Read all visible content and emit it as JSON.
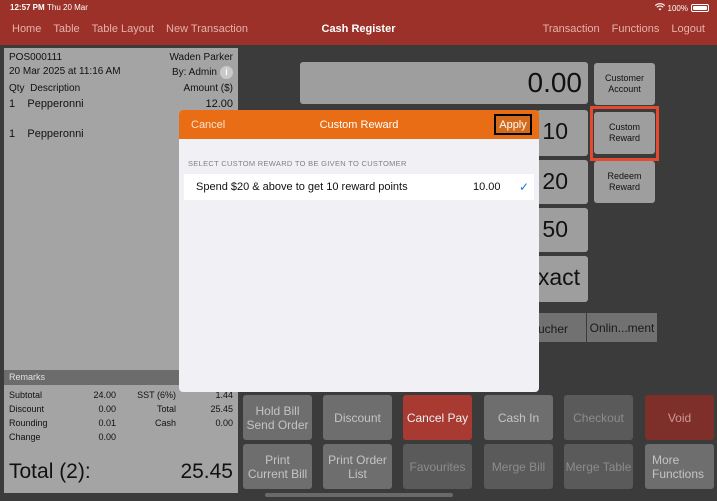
{
  "status": {
    "time": "12:57 PM",
    "date": "Thu 20 Mar",
    "battery": "100%"
  },
  "nav": {
    "left": [
      "Home",
      "Table",
      "Table Layout",
      "New Transaction"
    ],
    "title": "Cash Register",
    "right": [
      "Transaction",
      "Functions",
      "Logout"
    ]
  },
  "receipt": {
    "number": "POS000111",
    "customer": "Waden Parker",
    "datetime": "20 Mar 2025 at 11:16 AM",
    "by": "By: Admin",
    "headers": {
      "qty": "Qty",
      "desc": "Description",
      "amount": "Amount ($)"
    },
    "items": [
      {
        "qty": "1",
        "desc": "Pepperonni",
        "amount": "12.00"
      },
      {
        "qty": "1",
        "desc": "Pepperonni",
        "amount": ""
      }
    ],
    "remarks_label": "Remarks",
    "totals": [
      [
        "Subtotal",
        "24.00",
        "SST (6%)",
        "1.44"
      ],
      [
        "Discount",
        "0.00",
        "Total",
        "25.45"
      ],
      [
        "Rounding",
        "0.01",
        "Cash",
        "0.00"
      ],
      [
        "Change",
        "0.00",
        "",
        ""
      ]
    ],
    "grand_label": "Total (2):",
    "grand_value": "25.45"
  },
  "register": {
    "amount": "0.00",
    "cash_buttons": [
      "10",
      "20",
      "50",
      "xact"
    ],
    "voucher_partial": "ucher",
    "online_payment": "Onlin...ment"
  },
  "side_buttons": [
    {
      "line1": "Customer",
      "line2": "Account"
    },
    {
      "line1": "Custom",
      "line2": "Reward"
    },
    {
      "line1": "Redeem",
      "line2": "Reward"
    }
  ],
  "bottom": {
    "row1": [
      {
        "line1": "Hold Bill",
        "line2": "Send Order",
        "style": "b-gray"
      },
      {
        "line1": "Discount",
        "line2": "",
        "style": "b-gray"
      },
      {
        "line1": "Cancel Pay",
        "line2": "",
        "style": "b-red"
      },
      {
        "line1": "Cash In",
        "line2": "",
        "style": "b-gray"
      },
      {
        "line1": "Checkout",
        "line2": "",
        "style": "b-dim"
      },
      {
        "line1": "Void",
        "line2": "",
        "style": "b-darkred"
      }
    ],
    "row2": [
      {
        "line1": "Print",
        "line2": "Current Bill",
        "style": "b-gray"
      },
      {
        "line1": "Print Order",
        "line2": "List",
        "style": "b-gray"
      },
      {
        "line1": "Favourites",
        "line2": "",
        "style": "b-dim"
      },
      {
        "line1": "Merge Bill",
        "line2": "",
        "style": "b-dim"
      },
      {
        "line1": "Merge Table",
        "line2": "",
        "style": "b-dim"
      },
      {
        "line1": "More",
        "line2": "Functions",
        "style": "b-gray"
      }
    ]
  },
  "modal": {
    "cancel": "Cancel",
    "title": "Custom Reward",
    "apply": "Apply",
    "section_label": "SELECT CUSTOM REWARD TO BE GIVEN TO CUSTOMER",
    "reward_label": "Spend $20 & above to get 10 reward points",
    "reward_value": "10.00"
  }
}
